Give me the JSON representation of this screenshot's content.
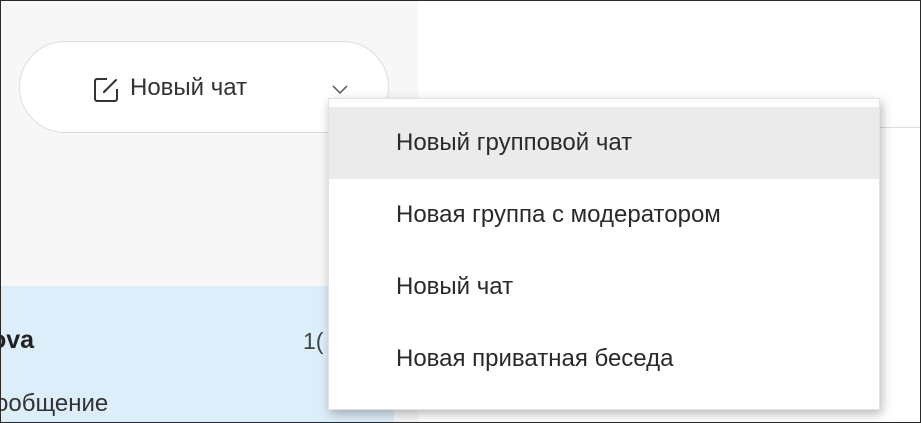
{
  "new_chat_button": {
    "label": "Новый чат",
    "icon": "compose-icon",
    "dropdown_icon": "chevron-down-icon"
  },
  "chat_list": {
    "items": [
      {
        "name": "ova",
        "time": "1(",
        "preview": "ообщение"
      }
    ]
  },
  "dropdown": {
    "items": [
      {
        "label": "Новый групповой чат",
        "highlighted": true
      },
      {
        "label": "Новая группа с модератором",
        "highlighted": false
      },
      {
        "label": "Новый чат",
        "highlighted": false
      },
      {
        "label": "Новая приватная беседа",
        "highlighted": false
      }
    ]
  },
  "colors": {
    "selected_row": "#dceefa",
    "menu_hover": "#ebebeb",
    "pane_background": "#f7f7f7"
  }
}
